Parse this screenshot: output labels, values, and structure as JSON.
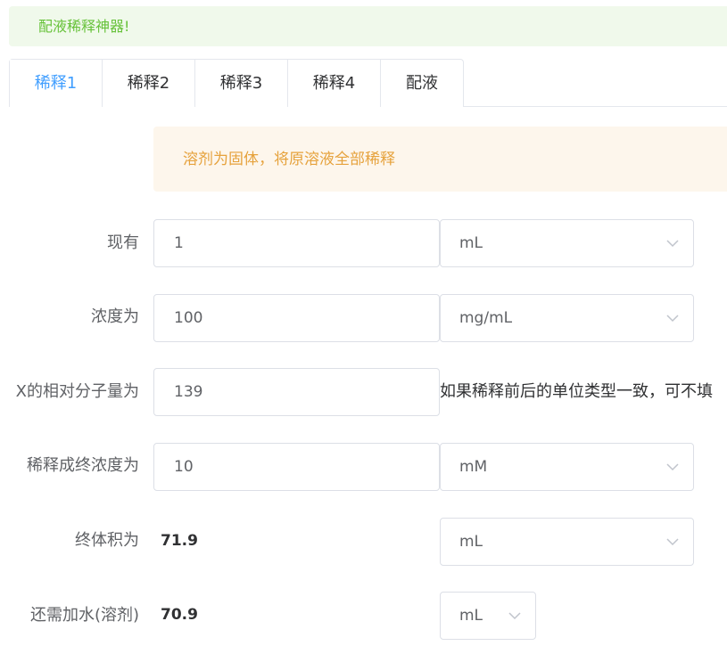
{
  "banner": {
    "text": "配液稀释神器!"
  },
  "tabs": [
    {
      "label": "稀释1",
      "active": true
    },
    {
      "label": "稀释2",
      "active": false
    },
    {
      "label": "稀释3",
      "active": false
    },
    {
      "label": "稀释4",
      "active": false
    },
    {
      "label": "配液",
      "active": false
    }
  ],
  "info": {
    "text": "溶剂为固体，将原溶液全部稀释"
  },
  "form": {
    "current": {
      "label": "现有",
      "value": "1",
      "unit": "mL"
    },
    "concentration": {
      "label": "浓度为",
      "value": "100",
      "unit": "mg/mL"
    },
    "molecular_weight": {
      "label": "X的相对分子量为",
      "value": "139",
      "hint": "如果稀释前后的单位类型一致，可不填"
    },
    "final_concentration": {
      "label": "稀释成终浓度为",
      "value": "10",
      "unit": "mM"
    },
    "final_volume": {
      "label": "终体积为",
      "value": "71.9",
      "unit": "mL"
    },
    "water_needed": {
      "label": "还需加水(溶剂)",
      "value": "70.9",
      "unit": "mL"
    }
  },
  "colors": {
    "success": "#67c23a",
    "warning": "#e6a23c",
    "primary": "#409eff"
  }
}
